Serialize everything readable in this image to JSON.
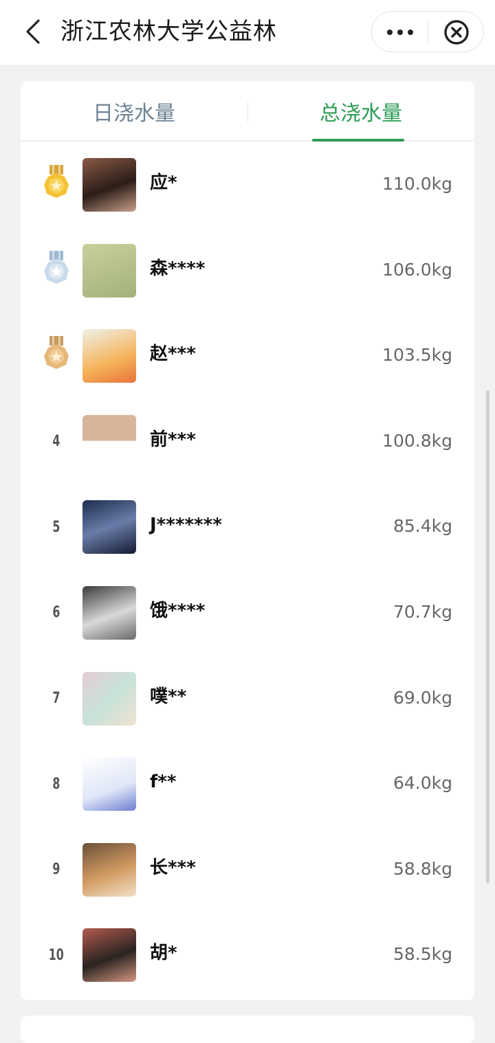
{
  "navbar": {
    "title": "浙江农林大学公益林"
  },
  "tabs": {
    "daily": "日浇水量",
    "total": "总浇水量",
    "active": "total",
    "accent": "#2e9c56"
  },
  "ranking": [
    {
      "rank": "1",
      "medal": "gold",
      "name": "应*",
      "amount": "110.0kg"
    },
    {
      "rank": "2",
      "medal": "silver",
      "name": "森****",
      "amount": "106.0kg"
    },
    {
      "rank": "3",
      "medal": "bronze",
      "name": "赵***",
      "amount": "103.5kg"
    },
    {
      "rank": "4",
      "medal": null,
      "name": "前***",
      "amount": "100.8kg"
    },
    {
      "rank": "5",
      "medal": null,
      "name": "J*******",
      "amount": "85.4kg"
    },
    {
      "rank": "6",
      "medal": null,
      "name": "饿****",
      "amount": "70.7kg"
    },
    {
      "rank": "7",
      "medal": null,
      "name": "噗**",
      "amount": "69.0kg"
    },
    {
      "rank": "8",
      "medal": null,
      "name": "f**",
      "amount": "64.0kg"
    },
    {
      "rank": "9",
      "medal": null,
      "name": "长***",
      "amount": "58.8kg"
    },
    {
      "rank": "10",
      "medal": null,
      "name": "胡*",
      "amount": "58.5kg"
    }
  ]
}
